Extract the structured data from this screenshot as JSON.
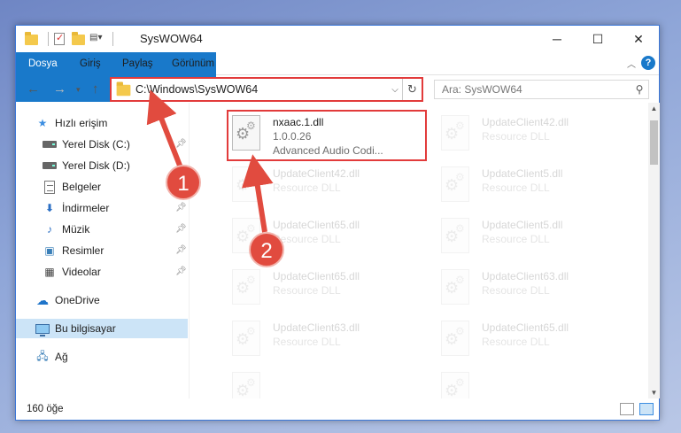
{
  "window": {
    "title": "SysWOW64"
  },
  "ribbon": {
    "tabs": [
      "Dosya",
      "Giriş",
      "Paylaş",
      "Görünüm"
    ]
  },
  "address": {
    "path": "C:\\Windows\\SysWOW64",
    "search_placeholder": "Ara: SysWOW64"
  },
  "nav": {
    "quick_access": "Hızlı erişim",
    "items": [
      {
        "label": "Yerel Disk (C:)",
        "icon": "drive-icon"
      },
      {
        "label": "Yerel Disk (D:)",
        "icon": "drive-icon"
      },
      {
        "label": "Belgeler",
        "icon": "document-icon"
      },
      {
        "label": "İndirmeler",
        "icon": "download-icon"
      },
      {
        "label": "Müzik",
        "icon": "music-icon"
      },
      {
        "label": "Resimler",
        "icon": "pictures-icon"
      },
      {
        "label": "Videolar",
        "icon": "video-icon"
      }
    ],
    "onedrive": "OneDrive",
    "this_pc": "Bu bilgisayar",
    "network": "Ağ"
  },
  "files": {
    "highlighted": {
      "name": "nxaac.1.dll",
      "version": "1.0.0.26",
      "description": "Advanced Audio Codi..."
    },
    "left_column": [
      {
        "name": "UpdateClient42.dll",
        "type": "Resource DLL"
      },
      {
        "name": "UpdateClient65.dll",
        "type": "Resource DLL"
      },
      {
        "name": "UpdateClient65.dll",
        "type": "Resource DLL"
      },
      {
        "name": "UpdateClient63.dll",
        "type": "Resource DLL"
      }
    ],
    "right_column": [
      {
        "name": "UpdateClient42.dll",
        "type": "Resource DLL"
      },
      {
        "name": "UpdateClient5.dll",
        "type": "Resource DLL"
      },
      {
        "name": "UpdateClient5.dll",
        "type": "Resource DLL"
      },
      {
        "name": "UpdateClient63.dll",
        "type": "Resource DLL"
      },
      {
        "name": "UpdateClient65.dll",
        "type": "Resource DLL"
      }
    ]
  },
  "status": {
    "item_count": "160 öğe"
  },
  "annotations": {
    "step1": "1",
    "step2": "2",
    "color": "#e14b3f"
  }
}
